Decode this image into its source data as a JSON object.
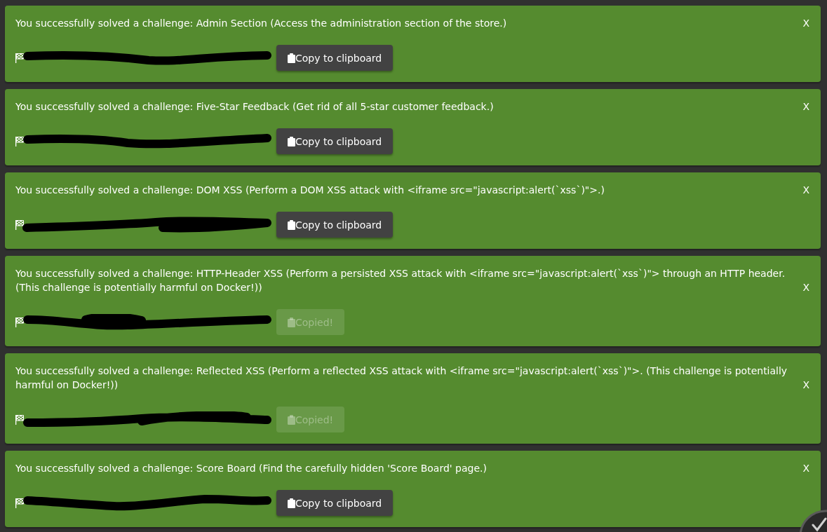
{
  "notifications": [
    {
      "message": "You successfully solved a challenge: Admin Section (Access the administration section of the store.)",
      "close_label": "X",
      "copy_button": {
        "label": "Copy to clipboard",
        "copied": false
      }
    },
    {
      "message": "You successfully solved a challenge: Five-Star Feedback (Get rid of all 5-star customer feedback.)",
      "close_label": "X",
      "copy_button": {
        "label": "Copy to clipboard",
        "copied": false
      }
    },
    {
      "message": "You successfully solved a challenge: DOM XSS (Perform a DOM XSS attack with <iframe src=\"javascript:alert(`xss`)\">.)",
      "close_label": "X",
      "copy_button": {
        "label": "Copy to clipboard",
        "copied": false
      }
    },
    {
      "message": "You successfully solved a challenge: HTTP-Header XSS (Perform a persisted XSS attack with <iframe src=\"javascript:alert(`xss`)\"> through an HTTP header. (This challenge is potentially harmful on Docker!))",
      "close_label": "X",
      "copy_button": {
        "label": "Copied!",
        "copied": true
      }
    },
    {
      "message": "You successfully solved a challenge: Reflected XSS (Perform a reflected XSS attack with <iframe src=\"javascript:alert(`xss`)\">. (This challenge is potentially harmful on Docker!))",
      "close_label": "X",
      "copy_button": {
        "label": "Copied!",
        "copied": true
      }
    },
    {
      "message": "You successfully solved a challenge: Score Board (Find the carefully hidden 'Score Board' page.)",
      "close_label": "X",
      "copy_button": {
        "label": "Copy to clipboard",
        "copied": false
      }
    }
  ]
}
